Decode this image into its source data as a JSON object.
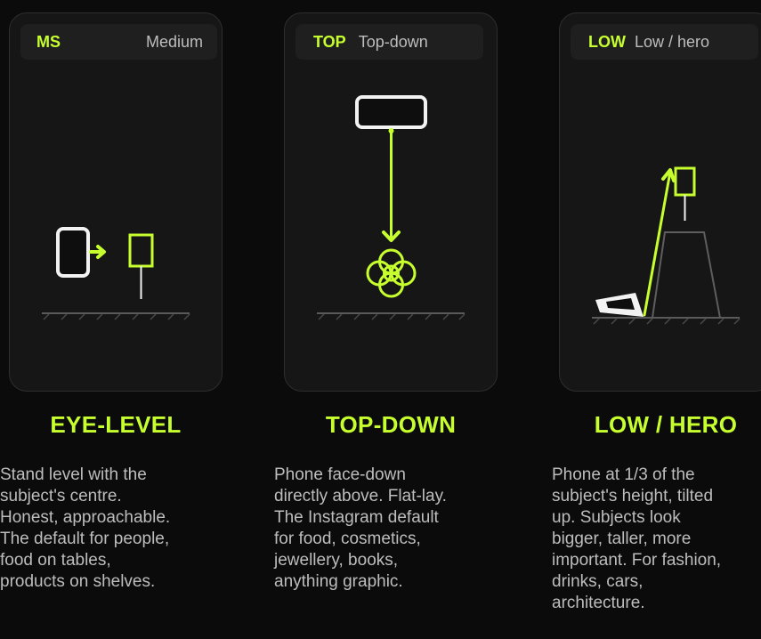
{
  "accent_color": "#c7ff2e",
  "cards": [
    {
      "code": "MS",
      "label": "Medium",
      "title": "EYE-LEVEL",
      "lines": [
        "Stand level with the",
        "subject's centre.",
        "Honest, approachable.",
        "The default for people,",
        "food on tables,",
        "products on shelves."
      ]
    },
    {
      "code": "TOP",
      "label": "Top-down",
      "title": "TOP-DOWN",
      "lines": [
        "Phone face-down",
        "directly above. Flat-lay.",
        "The Instagram default",
        "for food, cosmetics,",
        "jewellery, books,",
        "anything graphic."
      ]
    },
    {
      "code": "LOW",
      "label": "Low / hero",
      "title": "LOW / HERO",
      "lines": [
        "Phone at 1/3 of the",
        "subject's height, tilted",
        "up. Subjects look",
        "bigger, taller, more",
        "important. For fashion,",
        "drinks, cars,",
        "architecture."
      ]
    }
  ]
}
